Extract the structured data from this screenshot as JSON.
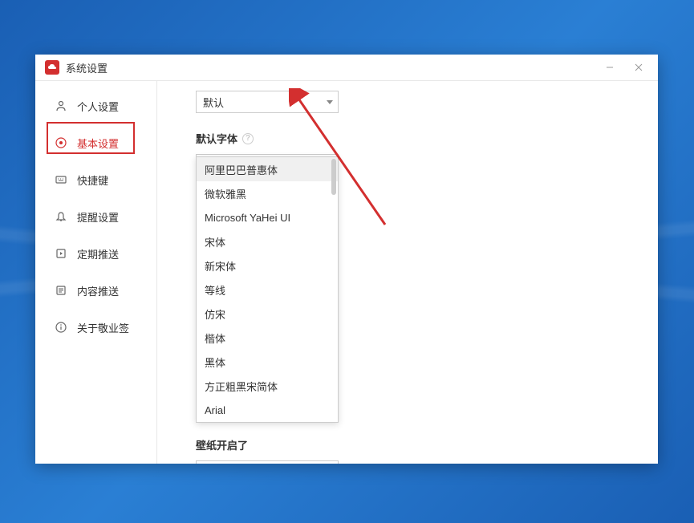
{
  "window": {
    "title": "系统设置",
    "icon_label": "云"
  },
  "sidebar": {
    "items": [
      {
        "label": "个人设置",
        "icon": "person"
      },
      {
        "label": "基本设置",
        "icon": "target"
      },
      {
        "label": "快捷键",
        "icon": "keyboard"
      },
      {
        "label": "提醒设置",
        "icon": "bell"
      },
      {
        "label": "定期推送",
        "icon": "play"
      },
      {
        "label": "内容推送",
        "icon": "content"
      },
      {
        "label": "关于敬业签",
        "icon": "info"
      }
    ]
  },
  "content": {
    "top_select": "默认",
    "font_section_label": "默认字体",
    "font_selected": "阿里巴巴普惠体",
    "dropdown_options": [
      "阿里巴巴普惠体",
      "微软雅黑",
      "Microsoft YaHei UI",
      "宋体",
      "新宋体",
      "等线",
      "仿宋",
      "楷体",
      "黑体",
      "方正粗黑宋简体",
      "Arial"
    ],
    "hidden_label": "壁纸开启了"
  }
}
